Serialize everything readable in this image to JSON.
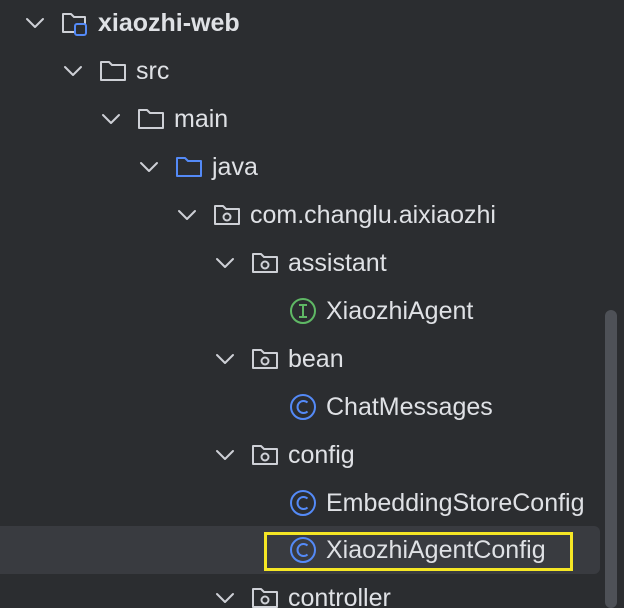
{
  "tree": {
    "project": "xiaozhi-web",
    "src": "src",
    "main": "main",
    "java": "java",
    "package": "com.changlu.aixiaozhi",
    "assistant": "assistant",
    "xiaozhi_agent": "XiaozhiAgent",
    "bean": "bean",
    "chat_messages": "ChatMessages",
    "config": "config",
    "embedding_store_config": "EmbeddingStoreConfig",
    "xiaozhi_agent_config": "XiaozhiAgentConfig",
    "controller": "controller"
  },
  "icons": {
    "chevron": "chevron-down-icon",
    "module_folder": "module-folder-icon",
    "folder": "folder-icon",
    "source_folder": "source-root-folder-icon",
    "package": "package-icon",
    "interface": "interface-icon",
    "class": "class-icon"
  },
  "colors": {
    "background": "#2b2d30",
    "text": "#dfe1e5",
    "selection": "#393b40",
    "highlight_border": "#f5e625",
    "class_icon": "#548af7",
    "interface_icon": "#5fb865",
    "source_folder": "#548af7"
  },
  "selected_item": "XiaozhiAgentConfig"
}
